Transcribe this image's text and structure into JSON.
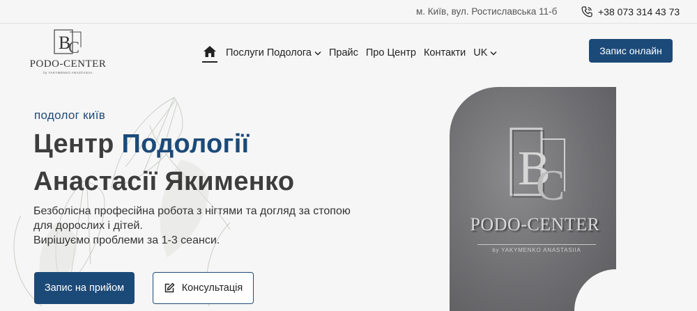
{
  "topbar": {
    "address": "м. Київ, вул. Ростиславська 11-б",
    "phone": "+38 073 314 43 73"
  },
  "logo": {
    "name": "PODO-CENTER",
    "subtitle": "by YAKYMENKO ANASTASIIA"
  },
  "nav": {
    "items": [
      {
        "label": "Послуги Подолога",
        "has_dropdown": true
      },
      {
        "label": "Прайс"
      },
      {
        "label": "Про Центр"
      },
      {
        "label": "Контакти"
      },
      {
        "label": "UK",
        "has_dropdown": true
      }
    ],
    "cta": "Запис онлайн"
  },
  "hero": {
    "kicker": "подолог київ",
    "title_part1": "Центр ",
    "title_accent": "Подології",
    "title_line2": "Анастасії Якименко",
    "desc_line1": "Безболісна професійна робота з нігтями та догляд за стопою",
    "desc_line2": "для дорослих і дітей.",
    "desc_line3": "Вирішуємо проблеми за 1-3 сеанси.",
    "btn_primary": "Запис на прийом",
    "btn_secondary": "Консультація"
  },
  "photo": {
    "sign_text": "PODO-CENTER",
    "sign_sub": "by YAKYMENKO ANASTASIIA"
  },
  "colors": {
    "accent": "#1c4a78",
    "background": "#f6f6f6",
    "text": "#3d3d3d"
  },
  "icons": [
    "phone-icon",
    "home-icon",
    "chevron-down-icon",
    "edit-icon"
  ]
}
